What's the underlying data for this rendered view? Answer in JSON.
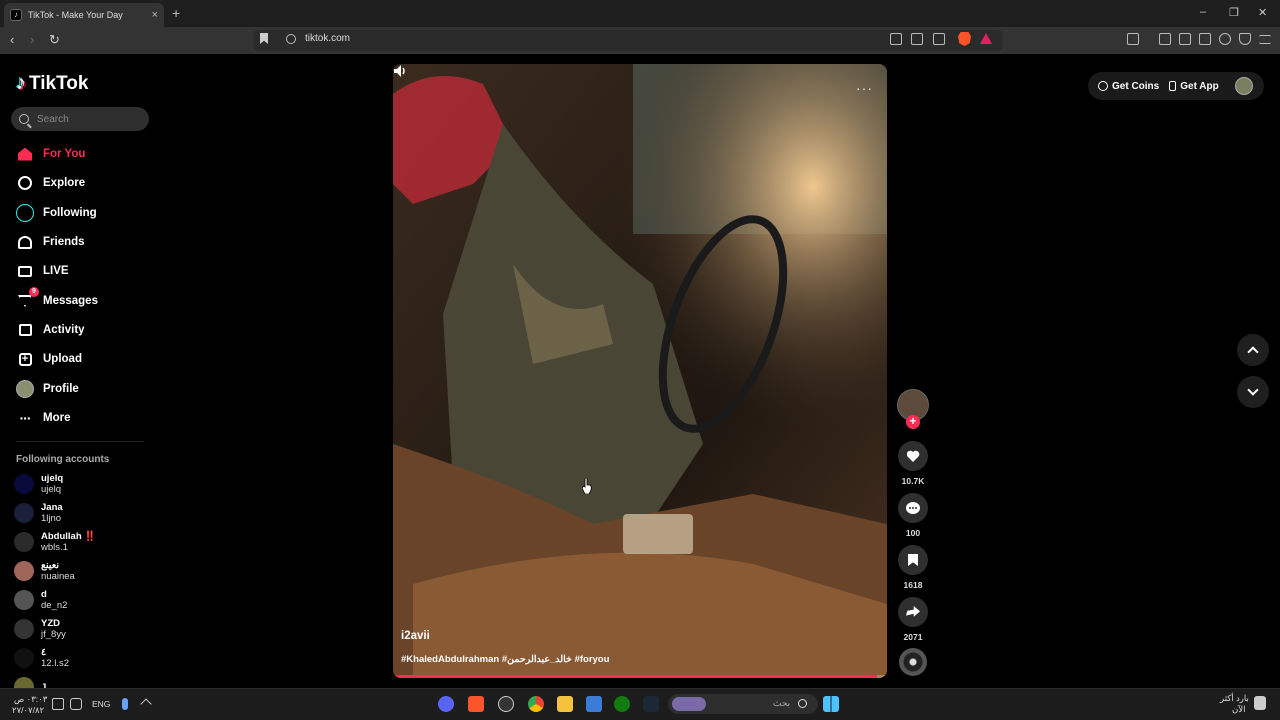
{
  "browser": {
    "tab_title": "TikTok - Make Your Day",
    "tab_close": "×",
    "new_tab": "+",
    "url": "tiktok.com",
    "window_controls": [
      "–",
      "❐",
      "✕"
    ],
    "nav": [
      "‹",
      "›",
      "↻"
    ]
  },
  "sidebar": {
    "logo_mark": "♪",
    "logo_text": "TikTok",
    "search_placeholder": "Search",
    "items": [
      {
        "label": "For You",
        "icon": "home-icon",
        "active": true
      },
      {
        "label": "Explore",
        "icon": "compass-icon"
      },
      {
        "label": "Following",
        "icon": "following-icon"
      },
      {
        "label": "Friends",
        "icon": "friends-icon"
      },
      {
        "label": "LIVE",
        "icon": "live-icon"
      },
      {
        "label": "Messages",
        "icon": "messages-icon",
        "badge": "9"
      },
      {
        "label": "Activity",
        "icon": "activity-icon"
      },
      {
        "label": "Upload",
        "icon": "upload-icon",
        "glyph": "+"
      },
      {
        "label": "Profile",
        "icon": "profile-avatar-icon"
      },
      {
        "label": "More",
        "icon": "more-icon",
        "glyph": "···"
      }
    ],
    "following_title": "Following accounts",
    "accounts": [
      {
        "name": "ujelq",
        "handle": "ujelq",
        "color": "#0a0a3a"
      },
      {
        "name": "Jana",
        "handle": "1ljno",
        "color": "#1a1f3a"
      },
      {
        "name": "Abdullah ‼️",
        "handle": "wbls.1",
        "color": "#2a2a2a"
      },
      {
        "name": "نعينع",
        "handle": "nuainea",
        "color": "#a0665a"
      },
      {
        "name": "d",
        "handle": "de_n2",
        "color": "#555"
      },
      {
        "name": "YZD",
        "handle": "jf_8yy",
        "color": "#333"
      },
      {
        "name": "٤",
        "handle": "12.l.s2",
        "color": "#111"
      },
      {
        "name": "J",
        "handle": "",
        "color": "#6a6a30"
      }
    ]
  },
  "video": {
    "username": "i2avii",
    "caption": "#KhaledAbdulrahman #خالد_عبدالرحمن #foryou",
    "more": "···",
    "progress": 0.98
  },
  "actions": {
    "follow": "+",
    "likes": "10.7K",
    "comments": "100",
    "saves": "1618",
    "shares": "2071"
  },
  "top": {
    "coins": "Get Coins",
    "app": "Get App"
  },
  "taskbar": {
    "time": "٠٣:٠٣ ص",
    "date": "٢٧/٠٧/٨٢",
    "lang": "ENG",
    "search_placeholder": "بحث",
    "weather_line1": "بارد أكثر",
    "weather_line2": "الآن"
  },
  "colors": {
    "accent": "#fe2c55",
    "cyan": "#25f4ee"
  }
}
